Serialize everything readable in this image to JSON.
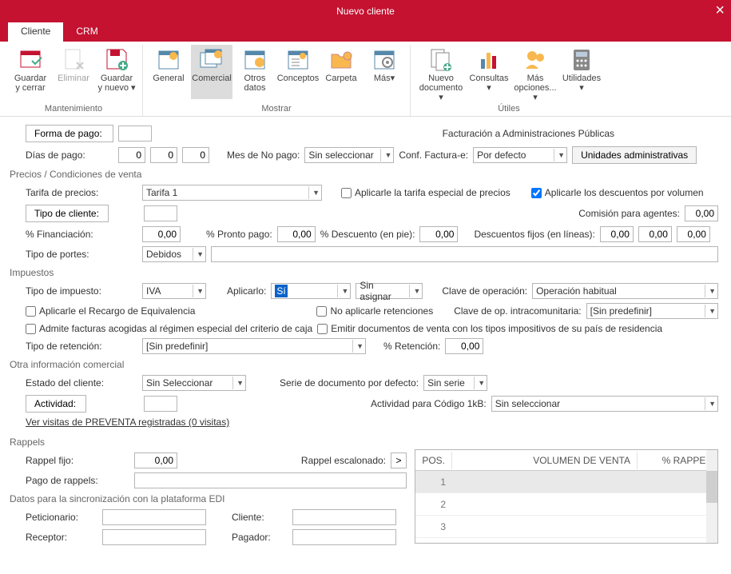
{
  "window": {
    "title": "Nuevo cliente"
  },
  "tabs": {
    "cliente": "Cliente",
    "crm": "CRM"
  },
  "ribbon": {
    "mantenimiento": {
      "label": "Mantenimiento",
      "guardar_cerrar": "Guardar\ny cerrar",
      "eliminar": "Eliminar",
      "guardar_nuevo": "Guardar\ny nuevo ▾"
    },
    "mostrar": {
      "label": "Mostrar",
      "general": "General",
      "comercial": "Comercial",
      "otros_datos": "Otros\ndatos",
      "conceptos": "Conceptos",
      "carpeta": "Carpeta",
      "mas": "Más▾"
    },
    "utiles": {
      "label": "Útiles",
      "nuevo_doc": "Nuevo\ndocumento ▾",
      "consultas": "Consultas\n▾",
      "mas_opciones": "Más\nopciones... ▾",
      "utilidades": "Utilidades\n▾"
    }
  },
  "forma_pago": {
    "label": "Forma de pago:",
    "value": ""
  },
  "facturacion_ap": "Facturación a Administraciones Públicas",
  "dias_pago": {
    "label": "Días de pago:",
    "d1": "0",
    "d2": "0",
    "d3": "0"
  },
  "mes_no_pago": {
    "label": "Mes de No pago:",
    "value": "Sin seleccionar"
  },
  "conf_factura": {
    "label": "Conf. Factura-e:",
    "value": "Por defecto"
  },
  "unidades_admin": "Unidades administrativas",
  "sec_precios": "Precios / Condiciones de venta",
  "tarifa": {
    "label": "Tarifa de precios:",
    "value": "Tarifa 1"
  },
  "chk_tarifa_especial": "Aplicarle la tarifa especial de precios",
  "chk_desc_volumen": "Aplicarle los descuentos por volumen",
  "tipo_cliente": {
    "label": "Tipo de cliente:",
    "value": ""
  },
  "comision_agentes": {
    "label": "Comisión para agentes:",
    "value": "0,00"
  },
  "financiacion": {
    "label": "% Financiación:",
    "value": "0,00"
  },
  "pronto_pago": {
    "label": "% Pronto pago:",
    "value": "0,00"
  },
  "desc_pie": {
    "label": "% Descuento (en pie):",
    "value": "0,00"
  },
  "desc_fijos": {
    "label": "Descuentos fijos (en líneas):",
    "v1": "0,00",
    "v2": "0,00",
    "v3": "0,00"
  },
  "tipo_portes": {
    "label": "Tipo de portes:",
    "value": "Debidos"
  },
  "sec_impuestos": "Impuestos",
  "tipo_impuesto": {
    "label": "Tipo de impuesto:",
    "value": "IVA"
  },
  "aplicarlo": {
    "label": "Aplicarlo:",
    "value": "Sí",
    "value2": "Sin asignar"
  },
  "clave_op": {
    "label": "Clave de operación:",
    "value": "Operación habitual"
  },
  "chk_recargo": "Aplicarle el Recargo de Equivalencia",
  "chk_no_retenciones": "No aplicarle retenciones",
  "clave_intra": {
    "label": "Clave de op. intracomunitaria:",
    "value": "[Sin predefinir]"
  },
  "chk_regimen_caja": "Admite facturas acogidas al régimen especial del criterio de caja",
  "chk_emitir_residencia": "Emitir documentos de venta con los tipos impositivos de su país de residencia",
  "tipo_retencion": {
    "label": "Tipo de retención:",
    "value": "[Sin predefinir]"
  },
  "pct_retencion": {
    "label": "% Retención:",
    "value": "0,00"
  },
  "sec_otra_info": "Otra información comercial",
  "estado_cliente": {
    "label": "Estado del cliente:",
    "value": "Sin Seleccionar"
  },
  "serie_doc": {
    "label": "Serie de documento por defecto:",
    "value": "Sin serie"
  },
  "actividad": {
    "label": "Actividad:",
    "value": ""
  },
  "actividad_1kb": {
    "label": "Actividad para Código 1kB:",
    "value": "Sin seleccionar"
  },
  "link_preventa": "Ver visitas de PREVENTA registradas (0 visitas)",
  "sec_rappels": "Rappels",
  "rappel_fijo": {
    "label": "Rappel fijo:",
    "value": "0,00"
  },
  "rappel_escalonado": "Rappel escalonado:",
  "pago_rappels": {
    "label": "Pago de rappels:",
    "value": ""
  },
  "sec_edi": "Datos para la sincronización con la plataforma EDI",
  "peticionario": {
    "label": "Peticionario:",
    "value": ""
  },
  "cliente_edi": {
    "label": "Cliente:",
    "value": ""
  },
  "receptor": {
    "label": "Receptor:",
    "value": ""
  },
  "pagador": {
    "label": "Pagador:",
    "value": ""
  },
  "table": {
    "col_pos": "POS.",
    "col_vol": "VOLUMEN DE VENTA",
    "col_rappel": "% RAPPEL",
    "rows": [
      {
        "pos": "1"
      },
      {
        "pos": "2"
      },
      {
        "pos": "3"
      }
    ]
  }
}
